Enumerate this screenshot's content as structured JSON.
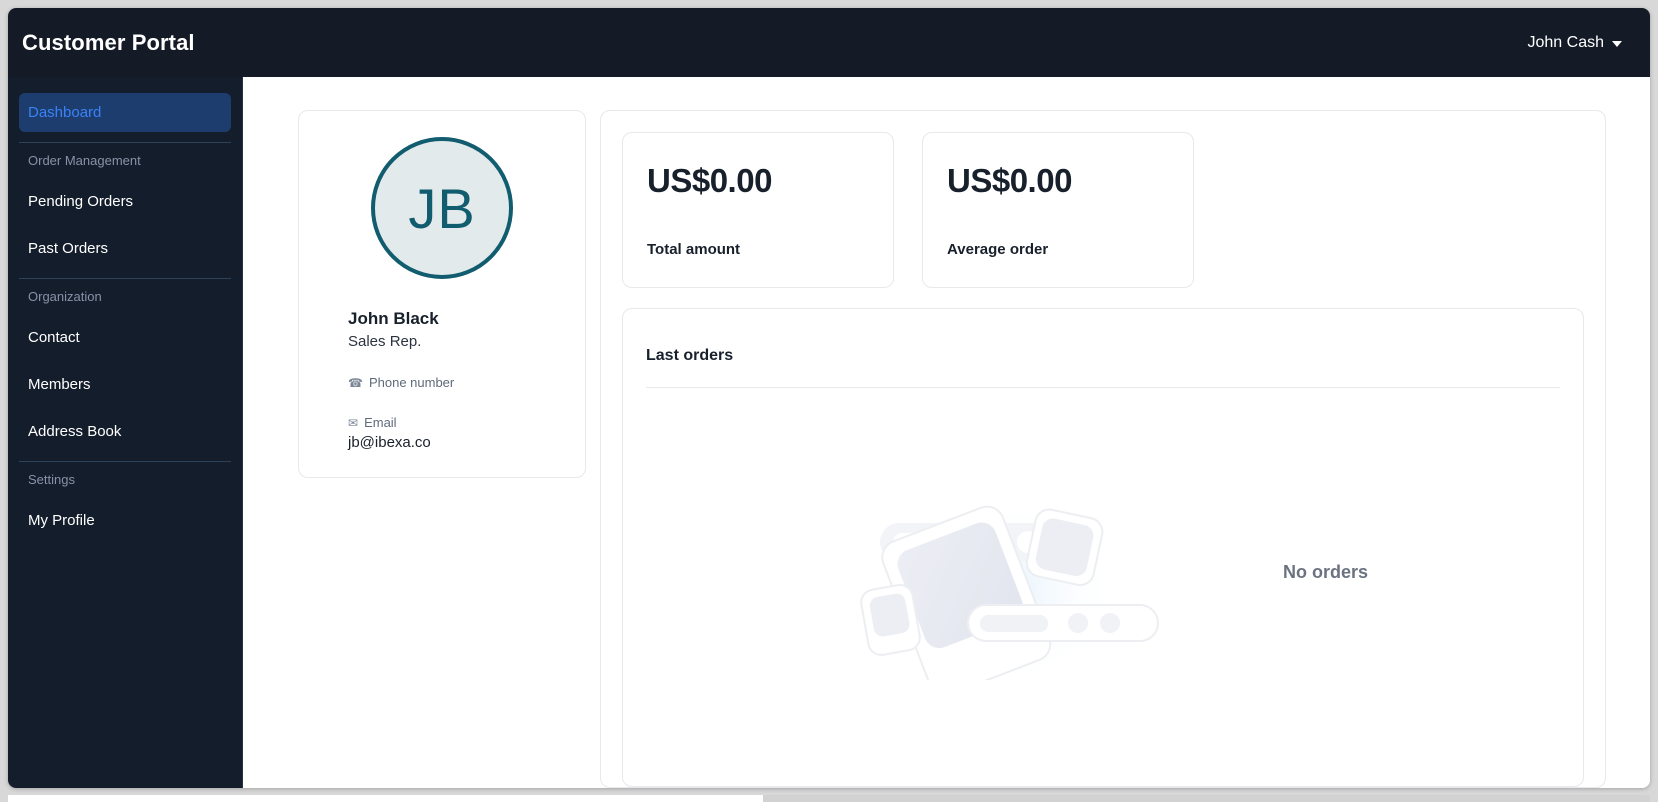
{
  "window": {
    "topbar": {
      "brand": "Customer Portal",
      "user_name": "John Cash",
      "caret_icon": "chevron-down-icon"
    }
  },
  "sidebar": {
    "items": [
      {
        "label": "Dashboard",
        "active": true
      }
    ],
    "sections": [
      {
        "label": "Order Management",
        "items": [
          {
            "label": "Pending Orders"
          },
          {
            "label": "Past Orders"
          }
        ]
      },
      {
        "label": "Organization",
        "items": [
          {
            "label": "Contact"
          },
          {
            "label": "Members"
          },
          {
            "label": "Address Book"
          }
        ]
      },
      {
        "label": "Settings",
        "items": [
          {
            "label": "My Profile"
          }
        ]
      }
    ]
  },
  "profile": {
    "avatar_initials": "JB",
    "name": "John Black",
    "role": "Sales Rep.",
    "phone": {
      "icon": "phone-icon",
      "label": "Phone number",
      "value": ""
    },
    "email": {
      "icon": "envelope-icon",
      "label": "Email",
      "value": "jb@ibexa.co"
    }
  },
  "stats": [
    {
      "value": "US$0.00",
      "label": "Total amount"
    },
    {
      "value": "US$0.00",
      "label": "Average order"
    }
  ],
  "orders": {
    "title": "Last orders",
    "empty_text": "No orders",
    "empty_illustration": "devices-illustration"
  },
  "colors": {
    "topbar_bg": "#141b26",
    "sidebar_bg": "#141d2b",
    "active_nav_bg": "#1c3d6e",
    "active_nav_text": "#3b82f6",
    "avatar_ring": "#115c6e",
    "avatar_fill": "#e3eaec",
    "text_primary": "#18202c",
    "text_muted": "#6b7280",
    "card_border": "#e8e8ed"
  }
}
